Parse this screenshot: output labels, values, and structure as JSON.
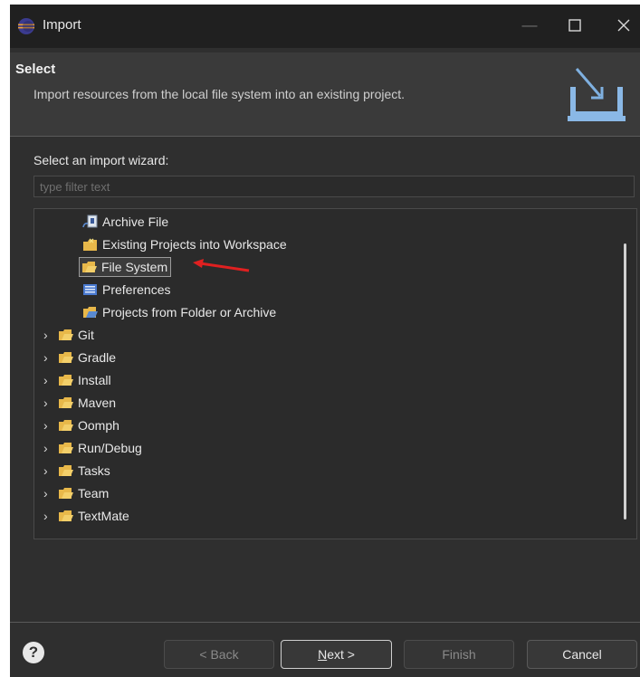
{
  "window": {
    "title": "Import"
  },
  "banner": {
    "title": "Select",
    "description": "Import resources from the local file system into an existing project."
  },
  "wizard": {
    "label": "Select an import wizard:",
    "filter_placeholder": "type filter text"
  },
  "tree": {
    "general_items": [
      {
        "label": "Archive File",
        "icon": "archive-file-icon"
      },
      {
        "label": "Existing Projects into Workspace",
        "icon": "existing-projects-icon"
      },
      {
        "label": "File System",
        "icon": "file-system-folder-icon",
        "selected": true
      },
      {
        "label": "Preferences",
        "icon": "preferences-icon"
      },
      {
        "label": "Projects from Folder or Archive",
        "icon": "projects-folder-icon"
      }
    ],
    "categories": [
      {
        "label": "Git"
      },
      {
        "label": "Gradle"
      },
      {
        "label": "Install"
      },
      {
        "label": "Maven"
      },
      {
        "label": "Oomph"
      },
      {
        "label": "Run/Debug"
      },
      {
        "label": "Tasks"
      },
      {
        "label": "Team"
      },
      {
        "label": "TextMate"
      }
    ]
  },
  "buttons": {
    "help": "?",
    "back": "< Back",
    "next_mnemonic": "N",
    "next_rest": "ext >",
    "finish": "Finish",
    "cancel": "Cancel"
  },
  "colors": {
    "window_bg": "#2f2f2f",
    "titlebar_bg": "#202020",
    "folder_yellow": "#e8b84a",
    "annotation_arrow": "#e02020"
  }
}
